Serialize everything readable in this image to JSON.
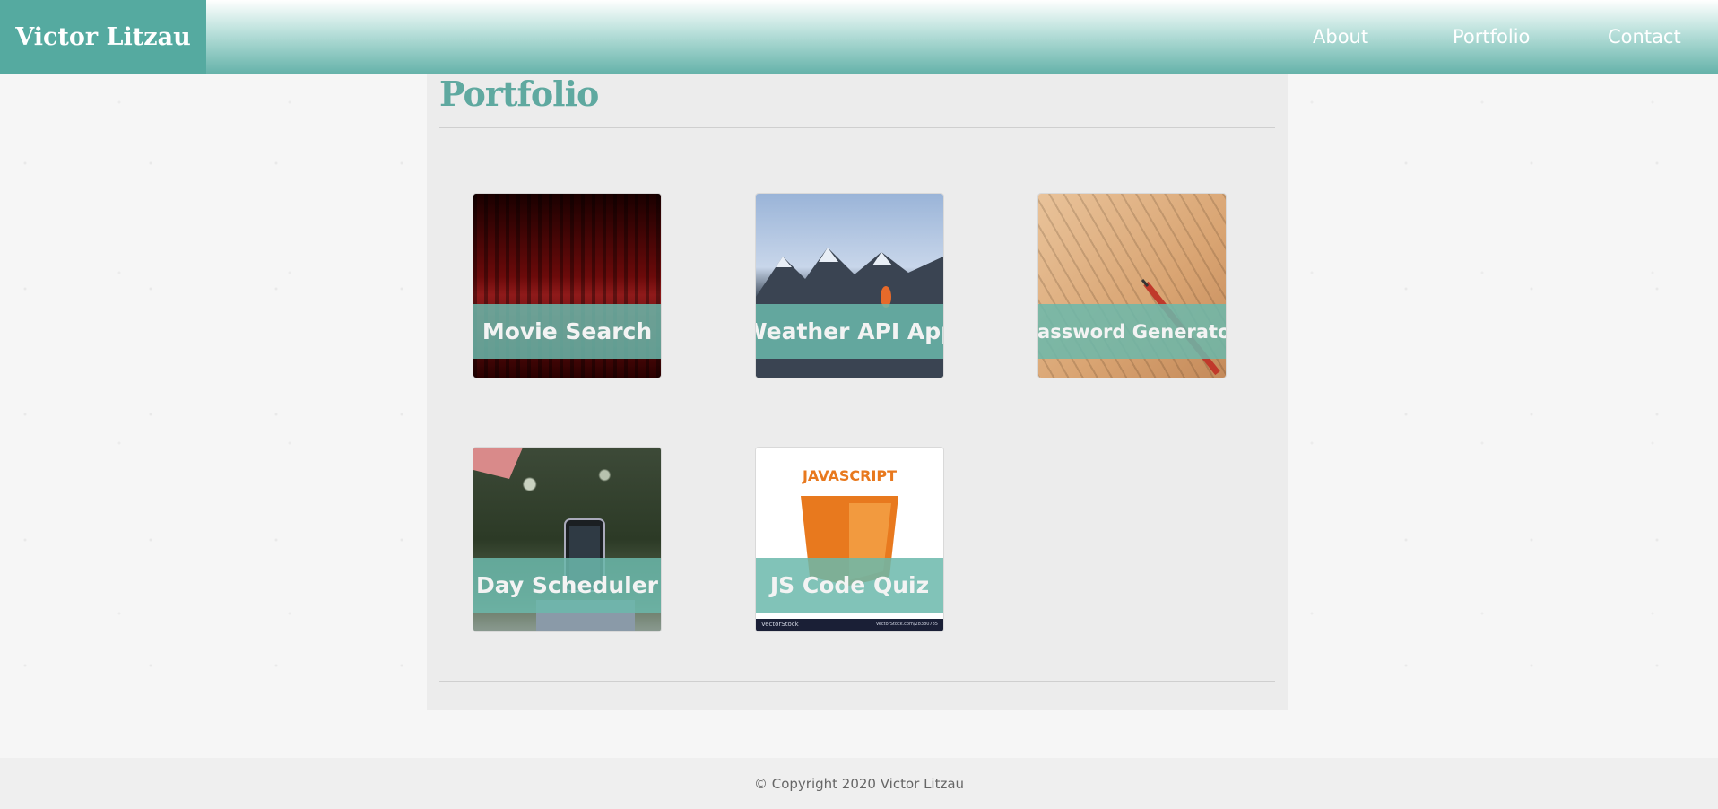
{
  "header": {
    "brand": "Victor Litzau",
    "nav": {
      "about": "About",
      "portfolio": "Portfolio",
      "contact": "Contact"
    }
  },
  "main": {
    "title": "Portfolio",
    "projects": [
      {
        "title": "Movie Search",
        "image": "theater-seats-image"
      },
      {
        "title": "Weather API App",
        "image": "mountain-campfire-image"
      },
      {
        "title": "Password Generator",
        "image": "paper-pencil-image"
      },
      {
        "title": "Day Scheduler",
        "image": "phone-in-hand-image"
      },
      {
        "title": "JS Code Quiz",
        "image": "javascript-logo-image"
      }
    ],
    "js_thumb": {
      "word": "JAVASCRIPT",
      "footer_left": "VectorStock",
      "footer_right": "VectorStock.com/28380785"
    }
  },
  "footer": {
    "copyright": "© Copyright 2020 Victor Litzau"
  },
  "colors": {
    "accent": "#5fa9a0",
    "header_bottom": "#66b3aa",
    "overlay": "#6bb9ac",
    "js_orange": "#e8791e"
  }
}
